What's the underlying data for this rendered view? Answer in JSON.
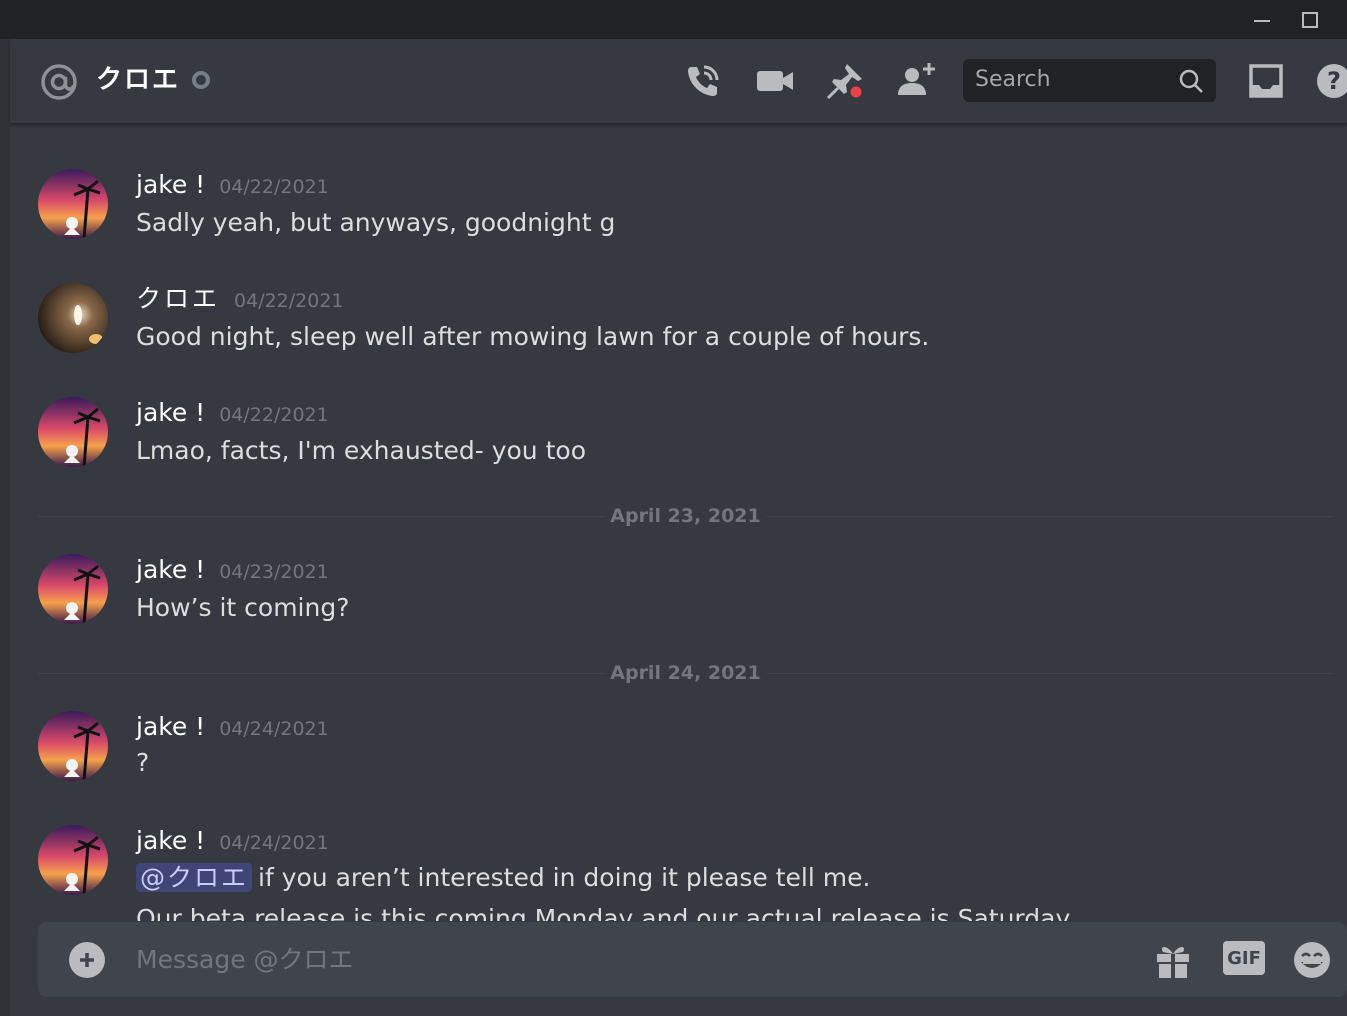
{
  "window": {
    "minimize_icon": "minimize-icon",
    "maximize_icon": "maximize-icon"
  },
  "header": {
    "channel_name": "クロエ",
    "status": "offline",
    "search_placeholder": "Search",
    "icons": [
      "call-icon",
      "video-icon",
      "pin-icon",
      "add-friend-icon",
      "search-icon",
      "inbox-icon",
      "help-icon"
    ]
  },
  "messages": [
    {
      "author": "jake !",
      "timestamp": "04/22/2021",
      "text": "Sadly yeah, but anyways, goodnight g",
      "avatar": "sunset-avatar"
    },
    {
      "author": "クロエ",
      "timestamp": "04/22/2021",
      "text": "Good night, sleep well after mowing lawn for a couple of hours.",
      "avatar": "candle-avatar"
    },
    {
      "author": "jake !",
      "timestamp": "04/22/2021",
      "text": "Lmao, facts, I'm exhausted- you too",
      "avatar": "sunset-avatar"
    },
    {
      "author": "jake !",
      "timestamp": "04/23/2021",
      "text": "How’s it coming?",
      "avatar": "sunset-avatar"
    },
    {
      "author": "jake !",
      "timestamp": "04/24/2021",
      "text": "?",
      "avatar": "sunset-avatar"
    },
    {
      "author": "jake !",
      "timestamp": "04/24/2021",
      "mention": "@クロエ",
      "text": "if you aren’t interested in doing it please tell me.",
      "continued_text": "Our beta release is this coming Monday and our actual release is Saturday",
      "avatar": "sunset-avatar"
    }
  ],
  "dividers": [
    "April 23, 2021",
    "April 24, 2021"
  ],
  "composer": {
    "placeholder": "Message @クロエ",
    "gif_label": "GIF",
    "icons": [
      "attach-plus-icon",
      "gift-icon",
      "gif-icon",
      "emoji-icon"
    ]
  },
  "colors": {
    "background": "#36393f",
    "titlebar": "#202225",
    "composer": "#40444b",
    "mention_accent": "#5865f2",
    "status_offline": "#747f8d",
    "pin_notification": "#ed4245"
  }
}
